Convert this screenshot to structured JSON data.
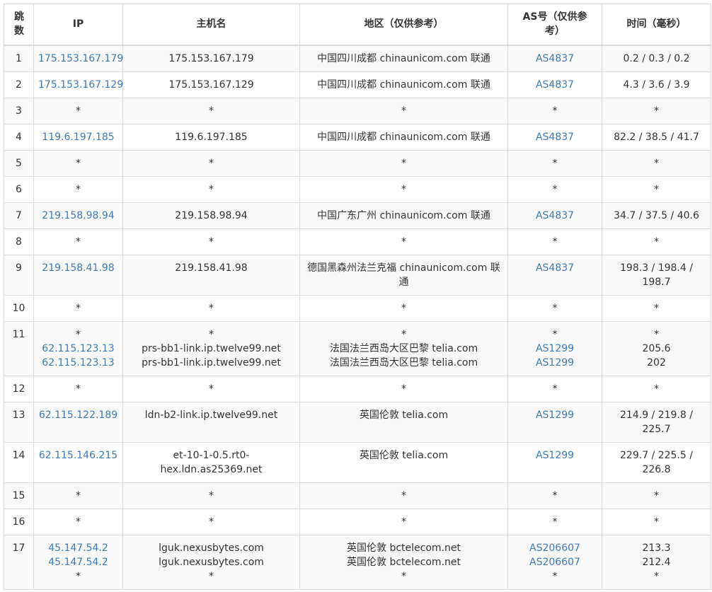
{
  "header": {
    "hop": "跳数",
    "ip": "IP",
    "host": "主机名",
    "region": "地区（仅供参考）",
    "as": "AS号（仅供参考）",
    "time": "时间（毫秒）"
  },
  "rows": [
    {
      "hop": "1",
      "ip": [
        "175.153.167.179"
      ],
      "host": [
        "175.153.167.179"
      ],
      "region": [
        "中国四川成都 chinaunicom.com 联通"
      ],
      "as": [
        "AS4837"
      ],
      "time": [
        "0.2 / 0.3 / 0.2"
      ]
    },
    {
      "hop": "2",
      "ip": [
        "175.153.167.129"
      ],
      "host": [
        "175.153.167.129"
      ],
      "region": [
        "中国四川成都 chinaunicom.com 联通"
      ],
      "as": [
        "AS4837"
      ],
      "time": [
        "4.3 / 3.6 / 3.9"
      ]
    },
    {
      "hop": "3",
      "ip": [
        "*"
      ],
      "host": [
        "*"
      ],
      "region": [
        "*"
      ],
      "as": [
        "*"
      ],
      "time": [
        "*"
      ]
    },
    {
      "hop": "4",
      "ip": [
        "119.6.197.185"
      ],
      "host": [
        "119.6.197.185"
      ],
      "region": [
        "中国四川成都 chinaunicom.com 联通"
      ],
      "as": [
        "AS4837"
      ],
      "time": [
        "82.2 / 38.5 / 41.7"
      ]
    },
    {
      "hop": "5",
      "ip": [
        "*"
      ],
      "host": [
        "*"
      ],
      "region": [
        "*"
      ],
      "as": [
        "*"
      ],
      "time": [
        "*"
      ]
    },
    {
      "hop": "6",
      "ip": [
        "*"
      ],
      "host": [
        "*"
      ],
      "region": [
        "*"
      ],
      "as": [
        "*"
      ],
      "time": [
        "*"
      ]
    },
    {
      "hop": "7",
      "ip": [
        "219.158.98.94"
      ],
      "host": [
        "219.158.98.94"
      ],
      "region": [
        "中国广东广州 chinaunicom.com 联通"
      ],
      "as": [
        "AS4837"
      ],
      "time": [
        "34.7 / 37.5 / 40.6"
      ]
    },
    {
      "hop": "8",
      "ip": [
        "*"
      ],
      "host": [
        "*"
      ],
      "region": [
        "*"
      ],
      "as": [
        "*"
      ],
      "time": [
        "*"
      ]
    },
    {
      "hop": "9",
      "ip": [
        "219.158.41.98"
      ],
      "host": [
        "219.158.41.98"
      ],
      "region": [
        "德国黑森州法兰克福 chinaunicom.com 联通"
      ],
      "as": [
        "AS4837"
      ],
      "time": [
        "198.3 / 198.4 / 198.7"
      ]
    },
    {
      "hop": "10",
      "ip": [
        "*"
      ],
      "host": [
        "*"
      ],
      "region": [
        "*"
      ],
      "as": [
        "*"
      ],
      "time": [
        "*"
      ]
    },
    {
      "hop": "11",
      "ip": [
        "*",
        "62.115.123.13",
        "62.115.123.13"
      ],
      "host": [
        "*",
        "prs-bb1-link.ip.twelve99.net",
        "prs-bb1-link.ip.twelve99.net"
      ],
      "region": [
        "*",
        "法国法兰西岛大区巴黎 telia.com",
        "法国法兰西岛大区巴黎 telia.com"
      ],
      "as": [
        "*",
        "AS1299",
        "AS1299"
      ],
      "time": [
        "*",
        "205.6",
        "202"
      ]
    },
    {
      "hop": "12",
      "ip": [
        "*"
      ],
      "host": [
        "*"
      ],
      "region": [
        "*"
      ],
      "as": [
        "*"
      ],
      "time": [
        "*"
      ]
    },
    {
      "hop": "13",
      "ip": [
        "62.115.122.189"
      ],
      "host": [
        "ldn-b2-link.ip.twelve99.net"
      ],
      "region": [
        "英国伦敦 telia.com"
      ],
      "as": [
        "AS1299"
      ],
      "time": [
        "214.9 / 219.8 / 225.7"
      ]
    },
    {
      "hop": "14",
      "ip": [
        "62.115.146.215"
      ],
      "host": [
        "et-10-1-0.5.rt0-hex.ldn.as25369.net"
      ],
      "region": [
        "英国伦敦 telia.com"
      ],
      "as": [
        "AS1299"
      ],
      "time": [
        "229.7 / 225.5 / 226.8"
      ]
    },
    {
      "hop": "15",
      "ip": [
        "*"
      ],
      "host": [
        "*"
      ],
      "region": [
        "*"
      ],
      "as": [
        "*"
      ],
      "time": [
        "*"
      ]
    },
    {
      "hop": "16",
      "ip": [
        "*"
      ],
      "host": [
        "*"
      ],
      "region": [
        "*"
      ],
      "as": [
        "*"
      ],
      "time": [
        "*"
      ]
    },
    {
      "hop": "17",
      "ip": [
        "45.147.54.2",
        "45.147.54.2",
        "*"
      ],
      "host": [
        "lguk.nexusbytes.com",
        "lguk.nexusbytes.com",
        "*"
      ],
      "region": [
        "英国伦敦 bctelecom.net",
        "英国伦敦 bctelecom.net",
        "*"
      ],
      "as": [
        "AS206607",
        "AS206607",
        "*"
      ],
      "time": [
        "213.3",
        "212.4",
        "*"
      ]
    }
  ]
}
